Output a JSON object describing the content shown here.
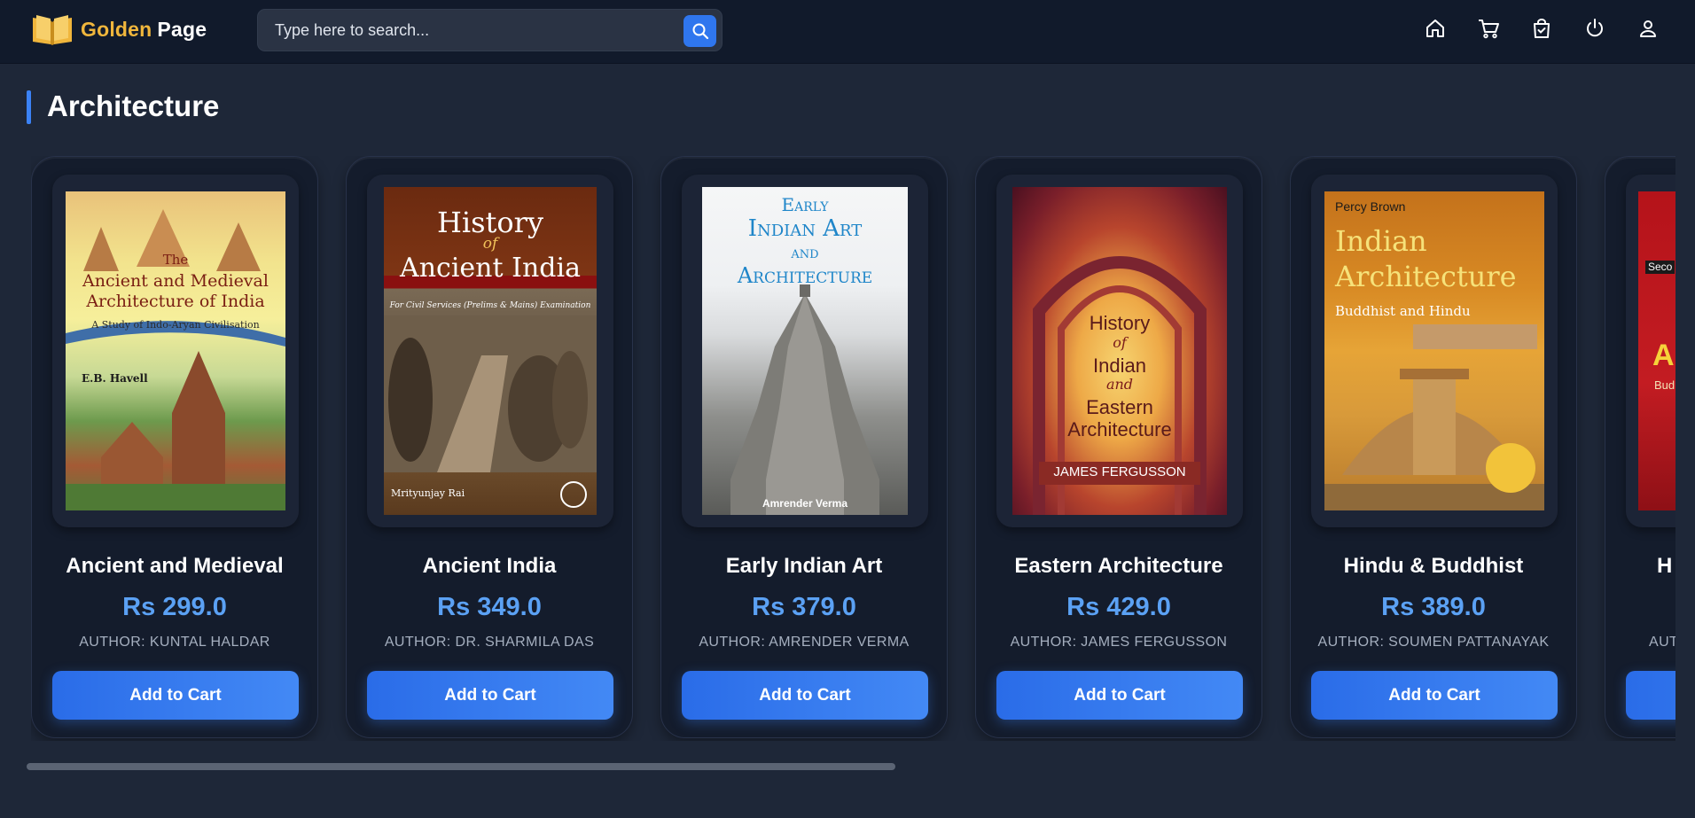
{
  "header": {
    "logo_word1": "Golden",
    "logo_word2": "Page",
    "search_placeholder": "Type here to search...",
    "icons": [
      "search-icon",
      "home-icon",
      "cart-icon",
      "shopping-bag-icon",
      "power-icon",
      "user-icon"
    ]
  },
  "section": {
    "title": "Architecture"
  },
  "colors": {
    "accent": "#3b82f6",
    "price": "#5ba1f4",
    "logo_gold": "#f0b63c",
    "background": "#1e2738"
  },
  "books": [
    {
      "title": "Ancient and Medieval",
      "price": "Rs 299.0",
      "author": "AUTHOR: KUNTAL HALDAR",
      "button": "Add to Cart",
      "cover_lines": [
        "The",
        "Ancient and Medieval",
        "Architecture of India",
        "A Study of Indo-Aryan Civilisation",
        "E.B. Havell"
      ]
    },
    {
      "title": "Ancient India",
      "price": "Rs 349.0",
      "author": "AUTHOR: DR. SHARMILA DAS",
      "button": "Add to Cart",
      "cover_lines": [
        "History",
        "of",
        "Ancient India",
        "For Civil Services (Prelims & Mains) Examination",
        "Mrityunjay Rai"
      ]
    },
    {
      "title": "Early Indian Art",
      "price": "Rs 379.0",
      "author": "AUTHOR: AMRENDER VERMA",
      "button": "Add to Cart",
      "cover_lines": [
        "Early",
        "Indian Art",
        "and",
        "Architecture",
        "Amrender Verma"
      ]
    },
    {
      "title": "Eastern Architecture",
      "price": "Rs 429.0",
      "author": "AUTHOR: JAMES FERGUSSON",
      "button": "Add to Cart",
      "cover_lines": [
        "History",
        "of",
        "Indian",
        "and",
        "Eastern",
        "Architecture",
        "JAMES FERGUSSON"
      ]
    },
    {
      "title": "Hindu & Buddhist",
      "price": "Rs 389.0",
      "author": "AUTHOR: SOUMEN PATTANAYAK",
      "button": "Add to Cart",
      "cover_lines": [
        "Percy Brown",
        "Indian",
        "Architecture",
        "Buddhist and Hindu"
      ]
    },
    {
      "title": "H",
      "price": "",
      "author": "AUT",
      "button": "",
      "cover_lines": [
        "Seco",
        "A",
        "Bud"
      ]
    }
  ]
}
